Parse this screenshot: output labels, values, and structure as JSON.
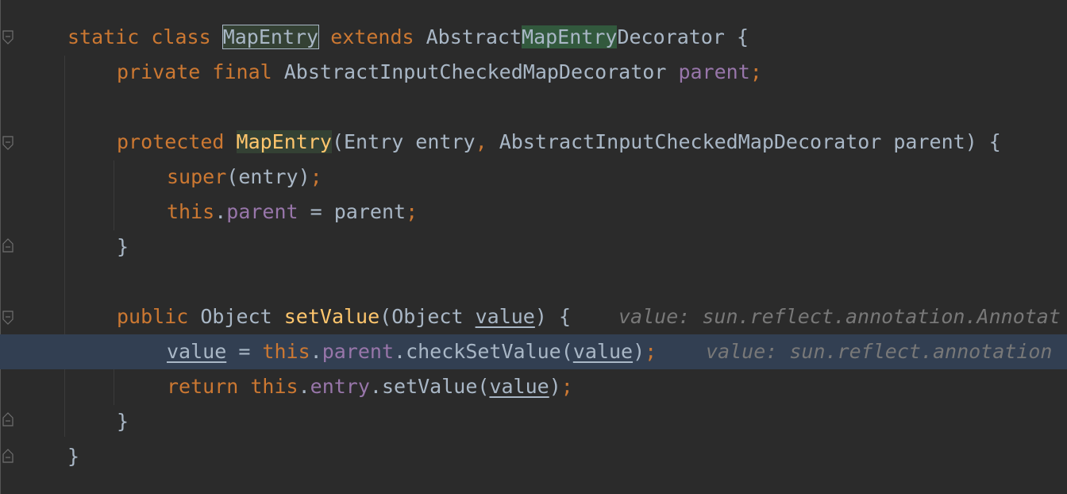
{
  "editor": {
    "lines": {
      "l1": {
        "kw_static": "static",
        "kw_class": "class",
        "class_name": "MapEntry",
        "kw_extends": "extends",
        "super_prefix": "Abstract",
        "super_mid": "MapEntry",
        "super_suffix": "Decorator",
        "brace": "{"
      },
      "l2": {
        "kw_private": "private",
        "kw_final": "final",
        "type": "AbstractInputCheckedMapDecorator",
        "field": "parent",
        "semi": ";"
      },
      "l4": {
        "kw_protected": "protected",
        "ctor": "MapEntry",
        "params_1": "(Entry entry",
        "comma": ",",
        "params_2": " AbstractInputCheckedMapDecorator parent) {"
      },
      "l5": {
        "kw_super": "super",
        "args": "(entry)",
        "semi": ";"
      },
      "l6": {
        "kw_this": "this",
        "dot": ".",
        "field": "parent",
        "rest": " = parent",
        "semi": ";"
      },
      "l7": {
        "brace": "}"
      },
      "l9": {
        "kw_public": "public",
        "type": "Object",
        "method": "setValue",
        "open": "(Object ",
        "param": "value",
        "close": ") {",
        "hint": "value: sun.reflect.annotation.Annotat"
      },
      "l10": {
        "var": "value",
        "eq": " = ",
        "kw_this": "this",
        "dot1": ".",
        "field": "parent",
        "call": ".checkSetValue(",
        "arg": "value",
        "close": ")",
        "semi": ";",
        "hint": "value: sun.reflect.annotation"
      },
      "l11": {
        "kw_return": "return",
        "kw_this": "this",
        "dot1": ".",
        "field": "entry",
        "call": ".setValue(",
        "arg": "value",
        "close": ")",
        "semi": ";"
      },
      "l12": {
        "brace": "}"
      },
      "l13": {
        "brace": "}"
      }
    },
    "colors": {
      "background": "#2b2b2b",
      "keyword": "#cc7832",
      "field": "#9876aa",
      "function": "#ffc66d",
      "text": "#a9b7c6",
      "hint": "#787878",
      "current_line": "#323f52",
      "usage_highlight": "#32593d"
    },
    "icons": {
      "fold_open": "fold-open-icon",
      "fold_close": "fold-close-icon"
    }
  }
}
